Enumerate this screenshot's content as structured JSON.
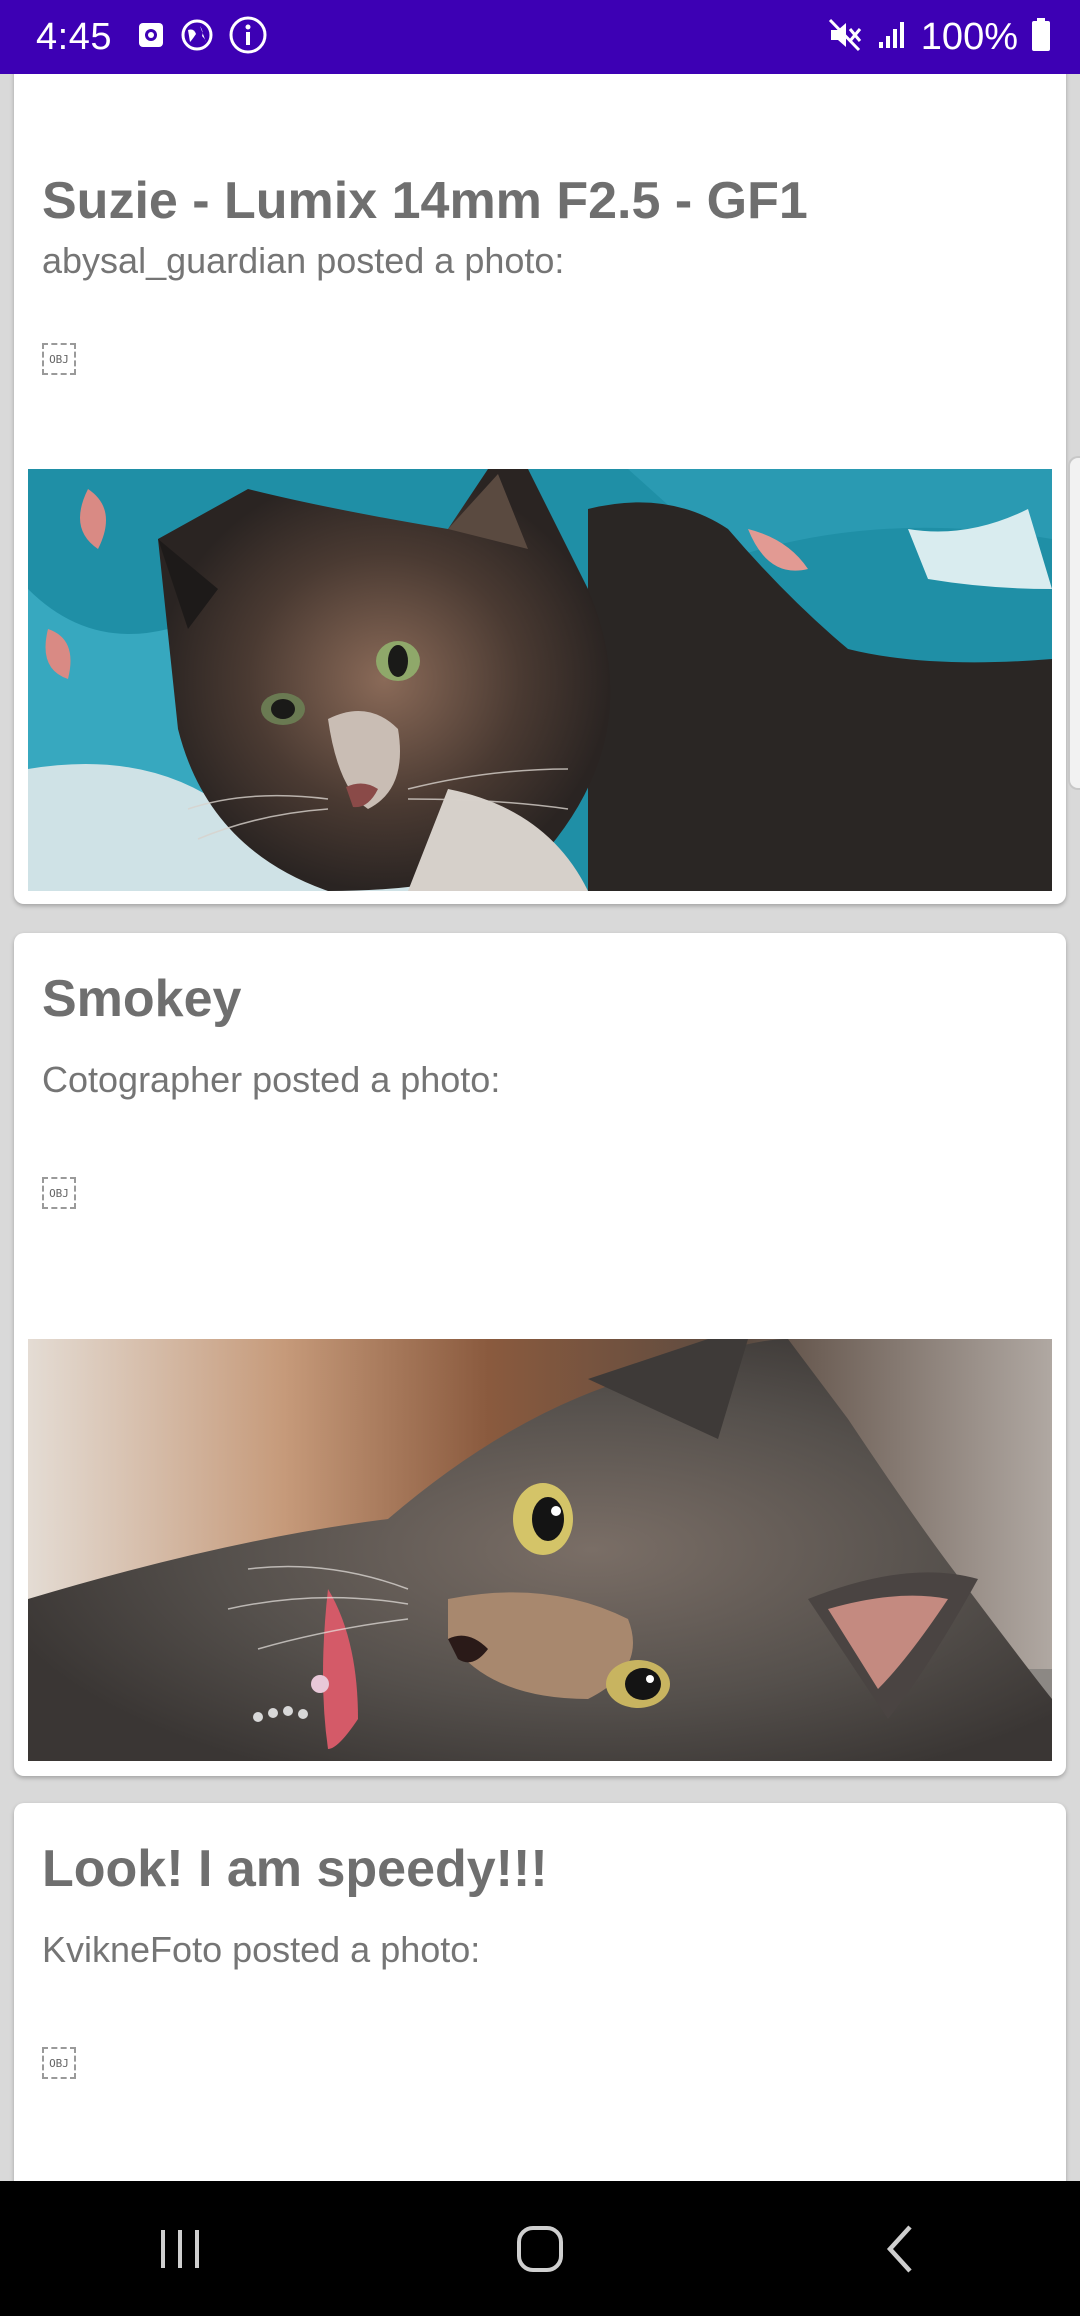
{
  "status_bar": {
    "time": "4:45",
    "battery": "100%",
    "icons": [
      "photo-notification-icon",
      "vpn-globe-icon",
      "info-icon",
      "mute-icon",
      "signal-icon",
      "battery-icon"
    ],
    "background": "#3d00b4"
  },
  "posts": [
    {
      "title": "Suzie - Lumix 14mm F2.5 - GF1",
      "subtitle": "abysal_guardian posted a photo:",
      "object_placeholder": "OBJ",
      "photo": "calico-cat-on-teal-blanket"
    },
    {
      "title": "Smokey",
      "subtitle": "Cotographer posted a photo:",
      "object_placeholder": "OBJ",
      "photo": "gray-tortie-cat-lying-sideways"
    },
    {
      "title": "Look! I am speedy!!!",
      "subtitle": "KvikneFoto posted a photo:",
      "object_placeholder": "OBJ"
    }
  ],
  "nav_bar": {
    "buttons": [
      "recents-icon",
      "home-icon",
      "back-icon"
    ]
  }
}
